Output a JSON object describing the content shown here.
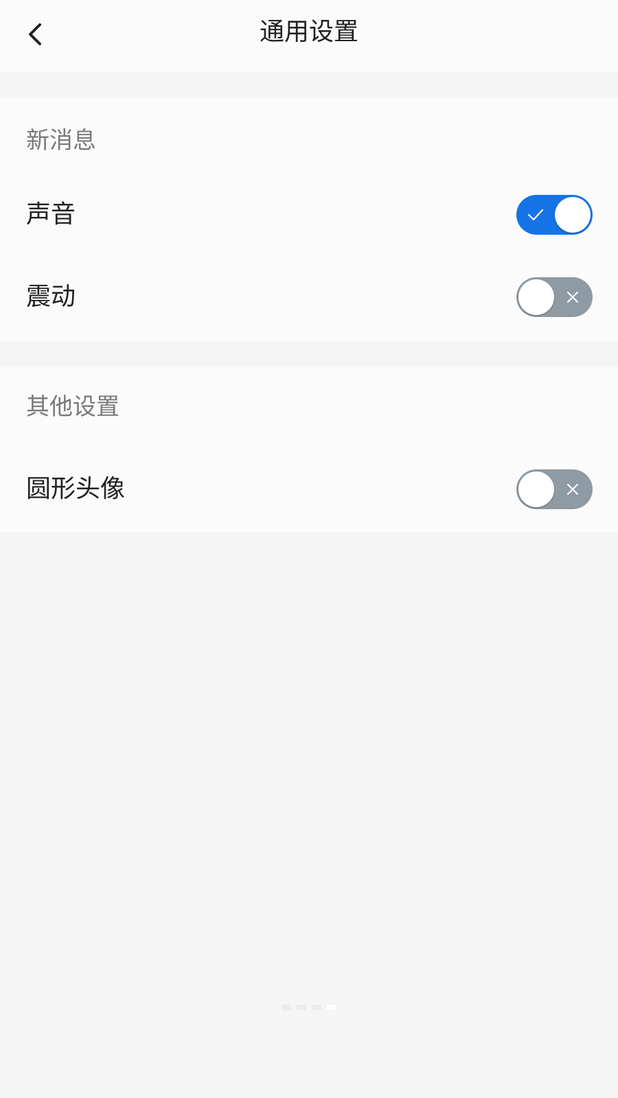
{
  "header": {
    "title": "通用设置",
    "back_icon": "chevron-left-icon"
  },
  "sections": [
    {
      "title": "新消息",
      "items": [
        {
          "label": "声音",
          "enabled": true
        },
        {
          "label": "震动",
          "enabled": false
        }
      ]
    },
    {
      "title": "其他设置",
      "items": [
        {
          "label": "圆形头像",
          "enabled": false
        }
      ]
    }
  ],
  "colors": {
    "toggle_on": "#1473e6",
    "toggle_off": "#8e9aa4",
    "background": "#f5f5f5",
    "panel": "#fbfbfb"
  }
}
